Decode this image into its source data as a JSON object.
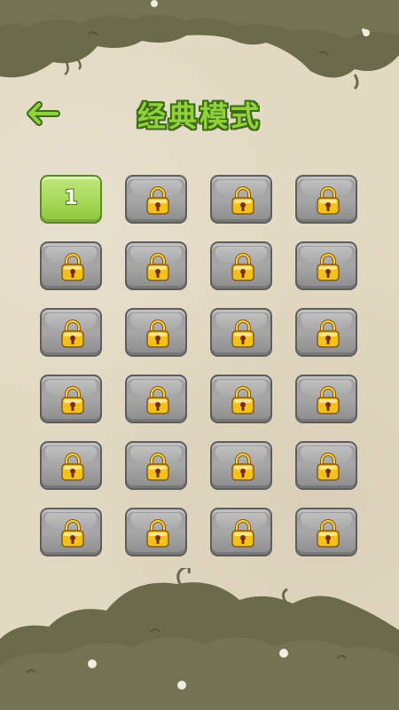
{
  "header": {
    "title": "经典模式",
    "back_icon": "back-arrow-icon"
  },
  "levels": [
    {
      "label": "1",
      "locked": false
    },
    {
      "label": "",
      "locked": true
    },
    {
      "label": "",
      "locked": true
    },
    {
      "label": "",
      "locked": true
    },
    {
      "label": "",
      "locked": true
    },
    {
      "label": "",
      "locked": true
    },
    {
      "label": "",
      "locked": true
    },
    {
      "label": "",
      "locked": true
    },
    {
      "label": "",
      "locked": true
    },
    {
      "label": "",
      "locked": true
    },
    {
      "label": "",
      "locked": true
    },
    {
      "label": "",
      "locked": true
    },
    {
      "label": "",
      "locked": true
    },
    {
      "label": "",
      "locked": true
    },
    {
      "label": "",
      "locked": true
    },
    {
      "label": "",
      "locked": true
    },
    {
      "label": "",
      "locked": true
    },
    {
      "label": "",
      "locked": true
    },
    {
      "label": "",
      "locked": true
    },
    {
      "label": "",
      "locked": true
    },
    {
      "label": "",
      "locked": true
    },
    {
      "label": "",
      "locked": true
    },
    {
      "label": "",
      "locked": true
    },
    {
      "label": "",
      "locked": true
    }
  ],
  "colors": {
    "title_fill": "#8fd23c",
    "title_outline": "#3f6b19",
    "unlocked_tile": "#a8d95a",
    "locked_tile": "#9d9d9d",
    "bush": "#6b6b4c",
    "paper": "#e2d9c2",
    "lock_gold": "#f2c21b"
  },
  "icons": {
    "lock": "padlock-icon",
    "back": "back-arrow-icon"
  }
}
